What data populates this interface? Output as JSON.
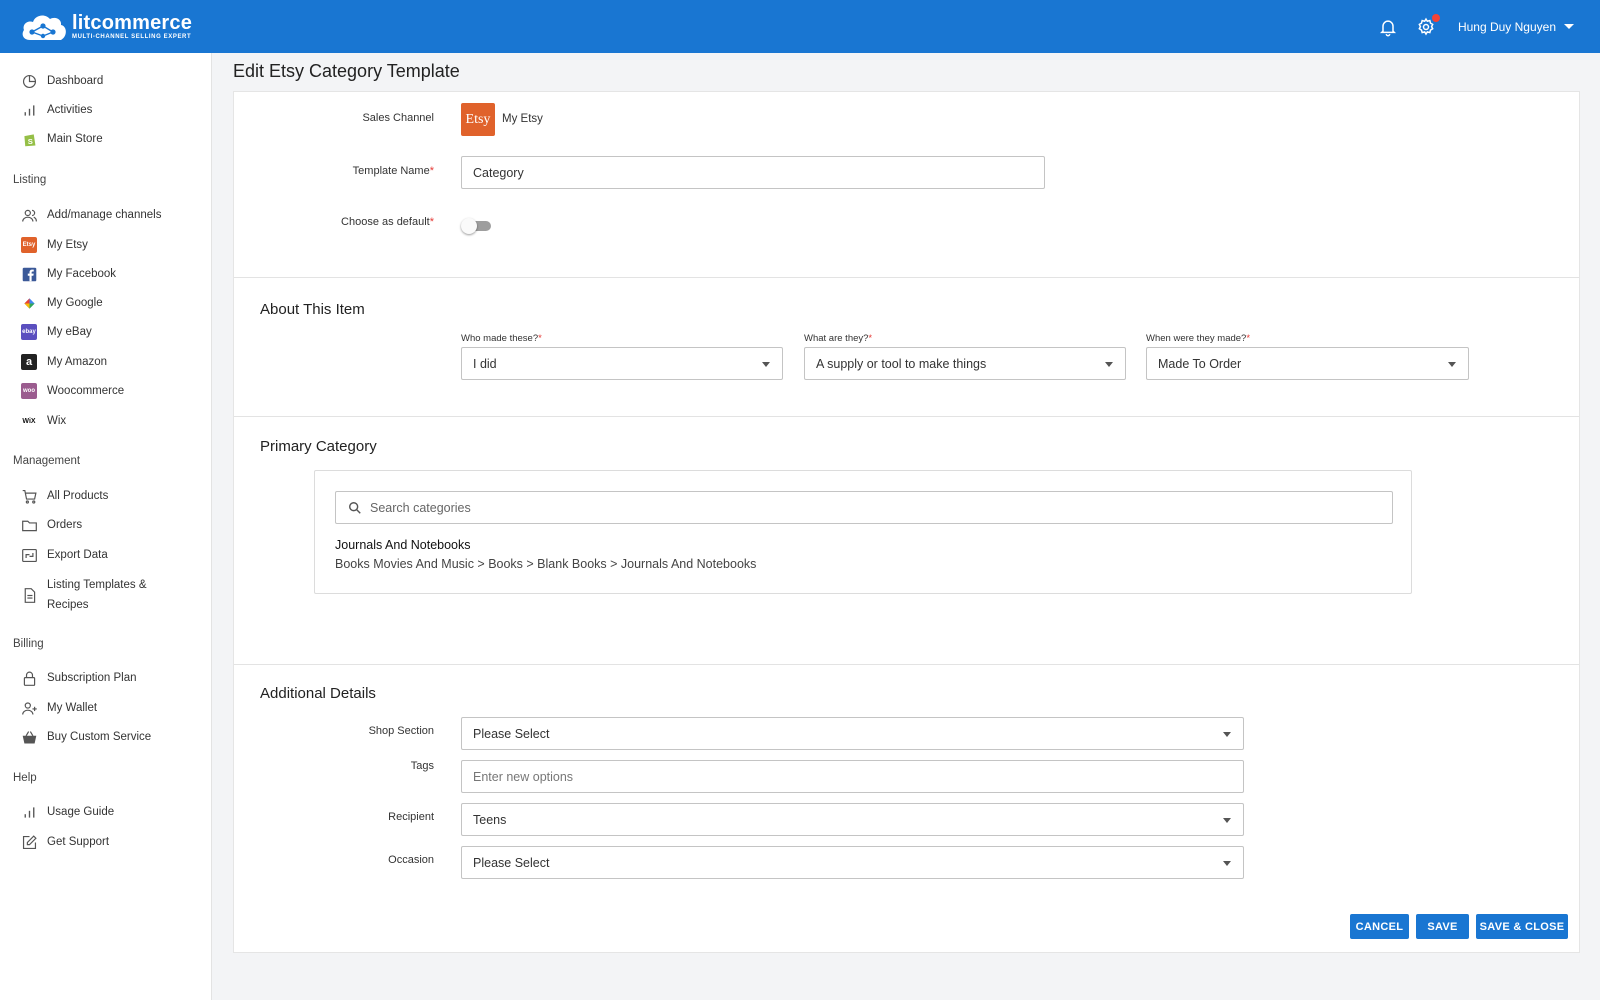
{
  "header": {
    "brand_name": "litcommerce",
    "brand_tagline": "MULTI-CHANNEL SELLING EXPERT",
    "user_name": "Hung Duy Nguyen"
  },
  "sidebar": {
    "top_items": [
      {
        "label": "Dashboard",
        "icon": "pie-chart-icon"
      },
      {
        "label": "Activities",
        "icon": "bar-chart-icon"
      },
      {
        "label": "Main Store",
        "icon": "shopify-icon"
      }
    ],
    "sections": {
      "listing": "Listing",
      "management": "Management",
      "billing": "Billing",
      "help": "Help"
    },
    "listing_items": [
      {
        "label": "Add/manage channels",
        "icon": "users-icon"
      },
      {
        "label": "My Etsy",
        "icon": "etsy-icon"
      },
      {
        "label": "My Facebook",
        "icon": "facebook-icon"
      },
      {
        "label": "My Google",
        "icon": "google-icon"
      },
      {
        "label": "My eBay",
        "icon": "ebay-icon"
      },
      {
        "label": "My Amazon",
        "icon": "amazon-icon"
      },
      {
        "label": "Woocommerce",
        "icon": "woocommerce-icon"
      },
      {
        "label": "Wix",
        "icon": "wix-icon"
      }
    ],
    "management_items": [
      {
        "label": "All Products",
        "icon": "cart-icon"
      },
      {
        "label": "Orders",
        "icon": "folder-icon"
      },
      {
        "label": "Export Data",
        "icon": "export-icon"
      },
      {
        "label": "Listing Templates &",
        "label2": "Recipes",
        "icon": "document-icon"
      }
    ],
    "billing_items": [
      {
        "label": "Subscription Plan",
        "icon": "lock-icon"
      },
      {
        "label": "My Wallet",
        "icon": "user-plus-icon"
      },
      {
        "label": "Buy Custom Service",
        "icon": "basket-icon"
      }
    ],
    "help_items": [
      {
        "label": "Usage Guide",
        "icon": "bar-chart-icon"
      },
      {
        "label": "Get Support",
        "icon": "edit-icon"
      }
    ],
    "brand_icon_text": {
      "etsy": "Etsy",
      "ebay": "ebay",
      "woo": "woo",
      "wix": "WiX",
      "amazon": "a"
    }
  },
  "page": {
    "title": "Edit Etsy Category Template"
  },
  "form": {
    "sales_channel_label": "Sales Channel",
    "channel_badge": "Etsy",
    "channel_name": "My Etsy",
    "template_name_label": "Template Name",
    "template_name_value": "Category",
    "default_label": "Choose as default",
    "required_mark": "*",
    "default_on": false
  },
  "about": {
    "title": "About This Item",
    "who_label": "Who made these?",
    "who_value": "I did",
    "what_label": "What are they?",
    "what_value": "A supply or tool to make things",
    "when_label": "When were they made?",
    "when_value": "Made To Order"
  },
  "primary_category": {
    "title": "Primary Category",
    "search_placeholder": "Search categories",
    "selected_name": "Journals And Notebooks",
    "selected_path": "Books Movies And Music > Books > Blank Books > Journals And Notebooks"
  },
  "additional": {
    "title": "Additional Details",
    "shop_section_label": "Shop Section",
    "shop_section_value": "Please Select",
    "tags_label": "Tags",
    "tags_placeholder": "Enter new options",
    "recipient_label": "Recipient",
    "recipient_value": "Teens",
    "occasion_label": "Occasion",
    "occasion_value": "Please Select"
  },
  "actions": {
    "cancel": "CANCEL",
    "save": "SAVE",
    "save_close": "SAVE & CLOSE"
  },
  "colors": {
    "primary": "#1976d2",
    "etsy": "#e0622b",
    "required": "#e53935",
    "notification_dot": "#f44336"
  }
}
